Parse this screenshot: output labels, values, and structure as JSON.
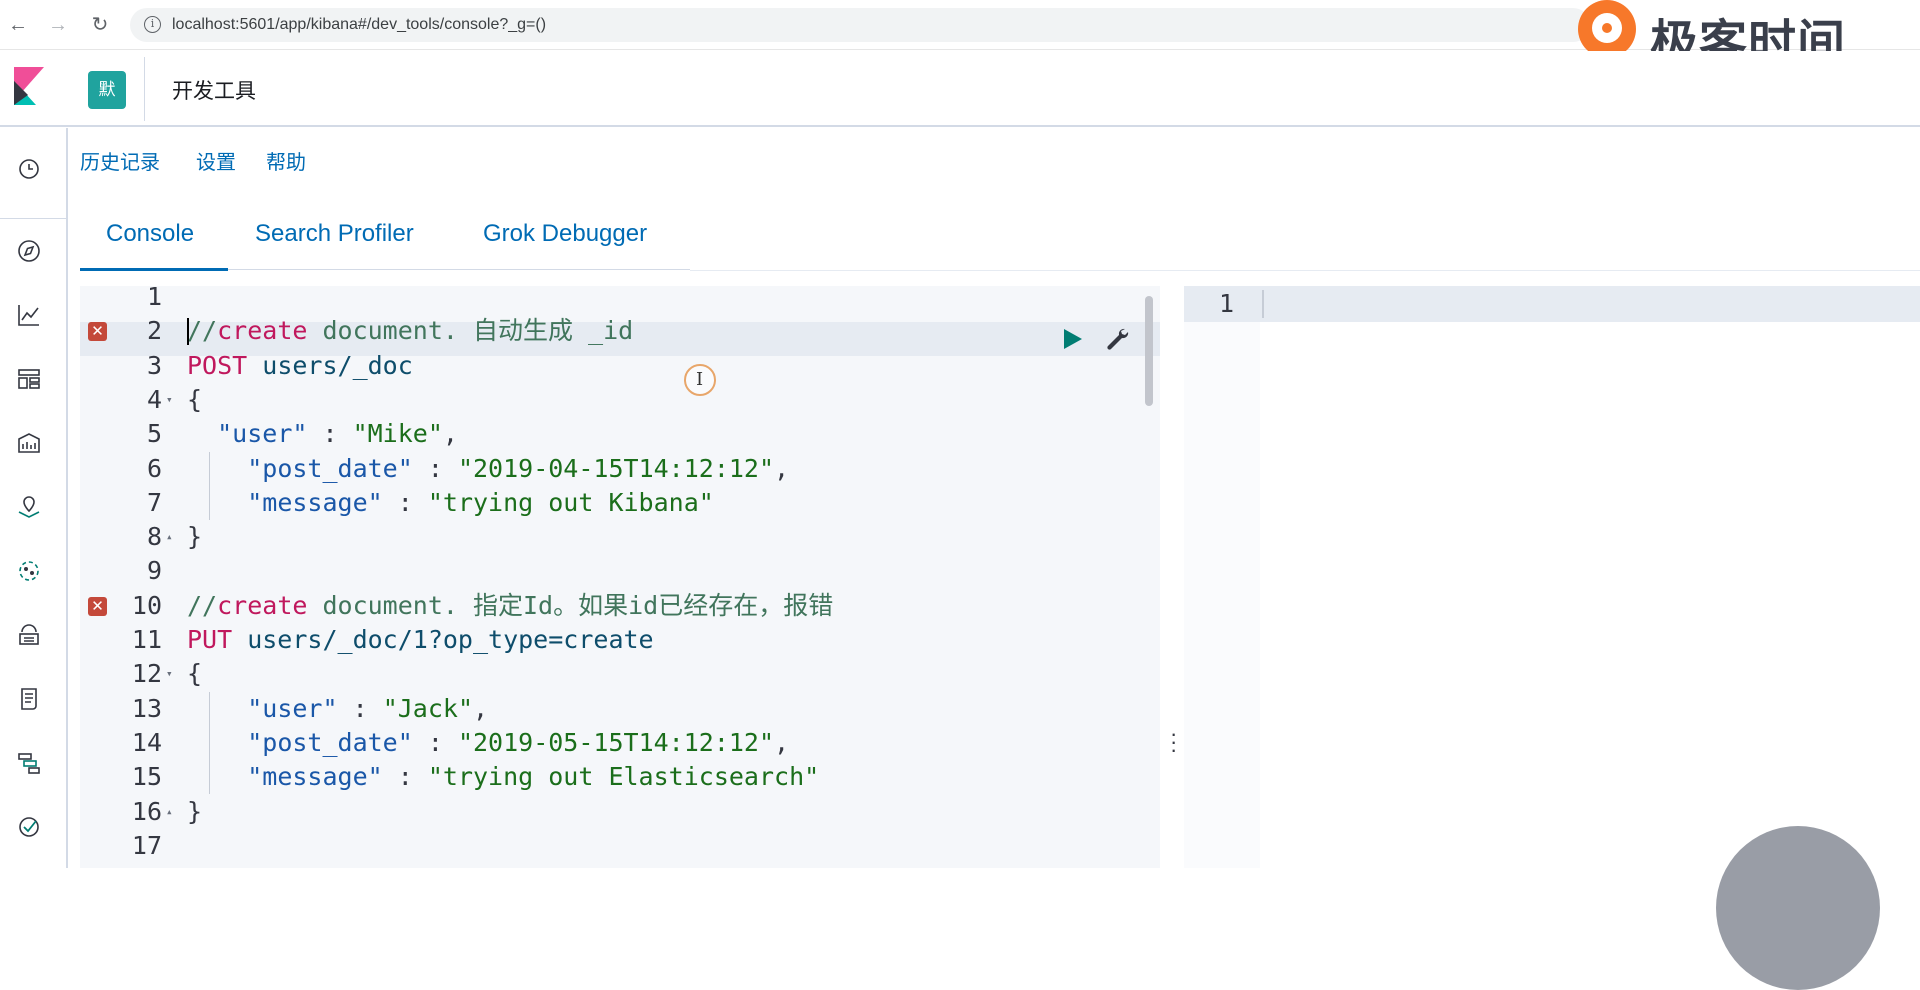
{
  "browser": {
    "url": "localhost:5601/app/kibana#/dev_tools/console?_g=()",
    "back_icon": "arrow-left-icon",
    "forward_icon": "arrow-right-icon",
    "reload_icon": "reload-icon"
  },
  "watermark": {
    "text": "极客时间"
  },
  "header": {
    "space_avatar": "默",
    "app_title": "开发工具"
  },
  "links": {
    "history": "历史记录",
    "settings": "设置",
    "help": "帮助"
  },
  "tabs": [
    {
      "label": "Console",
      "active": true
    },
    {
      "label": "Search Profiler",
      "active": false
    },
    {
      "label": "Grok Debugger",
      "active": false
    }
  ],
  "editor": {
    "lines": [
      {
        "n": "1"
      },
      {
        "n": "2",
        "error": true,
        "comment_prefix": "//",
        "comment_kw": "create",
        "comment_rest": " document. 自动生成 _id"
      },
      {
        "n": "3",
        "method": "POST",
        "path": " users/_doc"
      },
      {
        "n": "4",
        "fold": "▾",
        "punc": "{"
      },
      {
        "n": "5",
        "key": "\"user\"",
        "sep": " : ",
        "val": "\"Mike\"",
        "tail": ","
      },
      {
        "n": "6",
        "key": "\"post_date\"",
        "sep": " : ",
        "val": "\"2019-04-15T14:12:12\"",
        "tail": ","
      },
      {
        "n": "7",
        "key": "\"message\"",
        "sep": " : ",
        "val": "\"trying out Kibana\"",
        "tail": ""
      },
      {
        "n": "8",
        "fold": "▴",
        "punc": "}"
      },
      {
        "n": "9"
      },
      {
        "n": "10",
        "error": true,
        "comment_prefix": "//",
        "comment_kw": "create",
        "comment_rest": " document. 指定Id。如果id已经存在，报错"
      },
      {
        "n": "11",
        "method": "PUT",
        "path": " users/_doc/1?op_type=create"
      },
      {
        "n": "12",
        "fold": "▾",
        "punc": "{"
      },
      {
        "n": "13",
        "key": "\"user\"",
        "sep": " : ",
        "val": "\"Jack\"",
        "tail": ","
      },
      {
        "n": "14",
        "key": "\"post_date\"",
        "sep": " : ",
        "val": "\"2019-05-15T14:12:12\"",
        "tail": ","
      },
      {
        "n": "15",
        "key": "\"message\"",
        "sep": " : ",
        "val": "\"trying out Elasticsearch\"",
        "tail": ""
      },
      {
        "n": "16",
        "fold": "▴",
        "punc": "}"
      },
      {
        "n": "17"
      }
    ],
    "error_mark": "✕"
  },
  "output": {
    "line_number": "1"
  },
  "colors": {
    "accent": "#006bb4",
    "avatar": "#20a39e",
    "error": "#c4493a",
    "play": "#017d73"
  }
}
